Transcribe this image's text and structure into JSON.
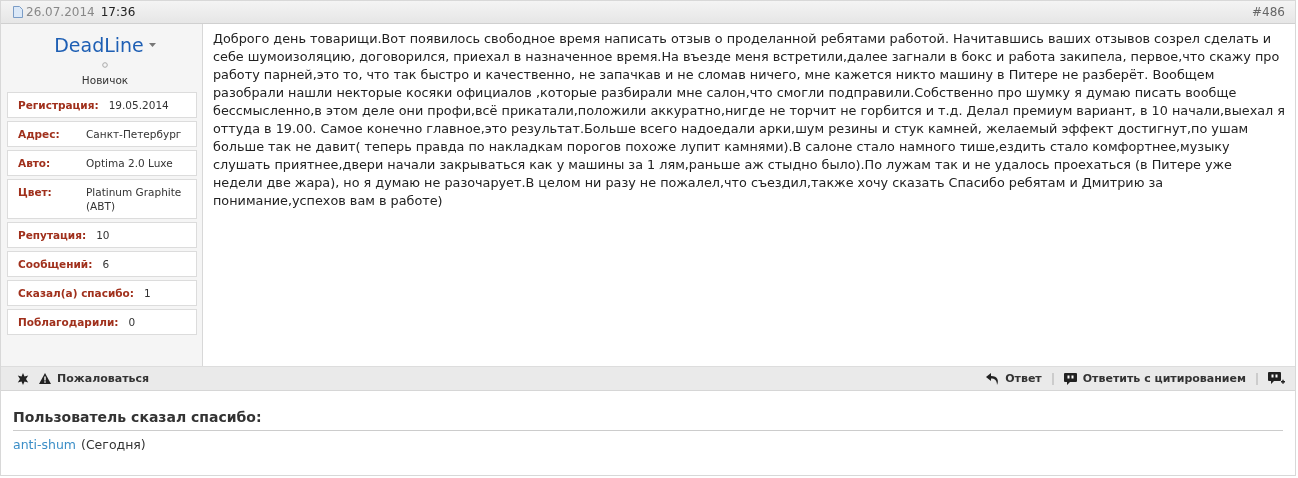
{
  "post_header": {
    "date": "26.07.2014",
    "time": "17:36",
    "number": "#486"
  },
  "author": {
    "name": "DeadLine",
    "rank": "Новичок",
    "online": false,
    "fields": [
      {
        "label": "Регистрация:",
        "value": "19.05.2014"
      },
      {
        "label": "Адрес:",
        "value": "Санкт-Петербург"
      },
      {
        "label": "Авто:",
        "value": "Optima 2.0 Luxe"
      },
      {
        "label": "Цвет:",
        "value": "Platinum Graphite (ABT)"
      },
      {
        "label": "Репутация:",
        "value": "10"
      },
      {
        "label": "Сообщений:",
        "value": "6"
      },
      {
        "label": "Сказал(а) спасибо:",
        "value": "1"
      },
      {
        "label": "Поблагодарили:",
        "value": "0"
      }
    ]
  },
  "message": "Доброго день товарищи.Вот появилось свободное время написать отзыв о проделанной ребятами работой. Начитавшись ваших отзывов созрел сделать и себе шумоизоляцию, договорился, приехал в назначенное время.На въезде меня встретили,далее загнали в бокс и работа закипела, первое,что скажу про работу парней,это то, что так быстро и качественно, не запачкав и не сломав ничего, мне кажется никто машину в Питере не разберёт. Вообщем разобрали нашли некторые косяки официалов ,которые разбирали мне салон,что смогли подправили.Собственно про шумку я думаю писать вообще бессмысленно,в этом деле они профи,всё прикатали,положили аккуратно,нигде не торчит не горбится и т.д. Делал премиум вариант, в 10 начали,выехал я оттуда в 19.00. Самое конечно главное,это результат.Больше всего надоедали арки,шум резины и стук камней, желаемый эффект достигнут,по ушам больше так не давит( теперь правда по накладкам порогов похоже лупит камнями).В салоне стало намного тише,ездить стало комфортнее,музыку слушать приятнее,двери начали закрываться как у машины за 1 лям,раньше аж стыдно было).По лужам так и не удалось проехаться (в Питере уже недели две жара), но я думаю не разочарует.В целом ни разу не пожалел,что съездил,также хочу сказать Спасибо ребятам и Дмитрию за понимание,успехов вам в работе)",
  "footer": {
    "left": [
      {
        "kind": "star"
      },
      {
        "kind": "report",
        "label": "Пожаловаться"
      }
    ],
    "right": [
      {
        "kind": "reply",
        "label": "Ответ"
      },
      {
        "kind": "quote",
        "label": "Ответить с цитированием"
      },
      {
        "kind": "multiquote"
      }
    ]
  },
  "thanks": {
    "title": "Пользователь сказал спасибо:",
    "users": [
      {
        "name": "anti-shum",
        "when": "(Сегодня)"
      }
    ]
  }
}
